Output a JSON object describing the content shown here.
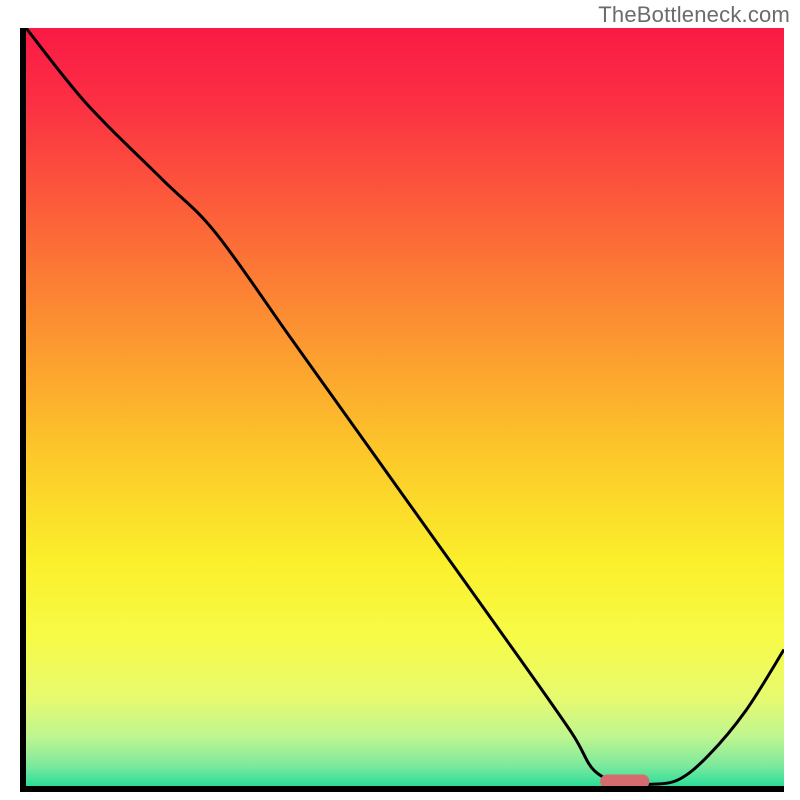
{
  "watermark": "TheBottleneck.com",
  "chart_data": {
    "type": "line",
    "title": "",
    "xlabel": "",
    "ylabel": "",
    "xlim": [
      0,
      100
    ],
    "ylim": [
      0,
      100
    ],
    "series": [
      {
        "name": "curve",
        "x": [
          0,
          8,
          18,
          25,
          35,
          45,
          55,
          65,
          72,
          75,
          79,
          82,
          86,
          90,
          95,
          100
        ],
        "y": [
          100,
          90,
          80,
          73,
          59,
          45,
          31,
          17,
          7,
          2,
          0.2,
          0.2,
          0.8,
          4,
          10,
          18
        ]
      }
    ],
    "marker": {
      "name": "highlight-pill",
      "x_center": 79,
      "y": 0.6,
      "width": 6.5,
      "color": "#d56b6e"
    },
    "background_gradient": {
      "stops": [
        {
          "pos": 0.0,
          "color": "#fa1a45"
        },
        {
          "pos": 0.1,
          "color": "#fb3043"
        },
        {
          "pos": 0.25,
          "color": "#fc6239"
        },
        {
          "pos": 0.4,
          "color": "#fc9431"
        },
        {
          "pos": 0.55,
          "color": "#fcc52a"
        },
        {
          "pos": 0.7,
          "color": "#fbef2b"
        },
        {
          "pos": 0.8,
          "color": "#f7fb47"
        },
        {
          "pos": 0.88,
          "color": "#e7fa6f"
        },
        {
          "pos": 0.93,
          "color": "#c0f68f"
        },
        {
          "pos": 0.97,
          "color": "#7ce99d"
        },
        {
          "pos": 1.0,
          "color": "#1fdc98"
        }
      ]
    },
    "axes_color": "#000000",
    "axes_width": 6,
    "line_color": "#000000",
    "line_width": 3
  }
}
